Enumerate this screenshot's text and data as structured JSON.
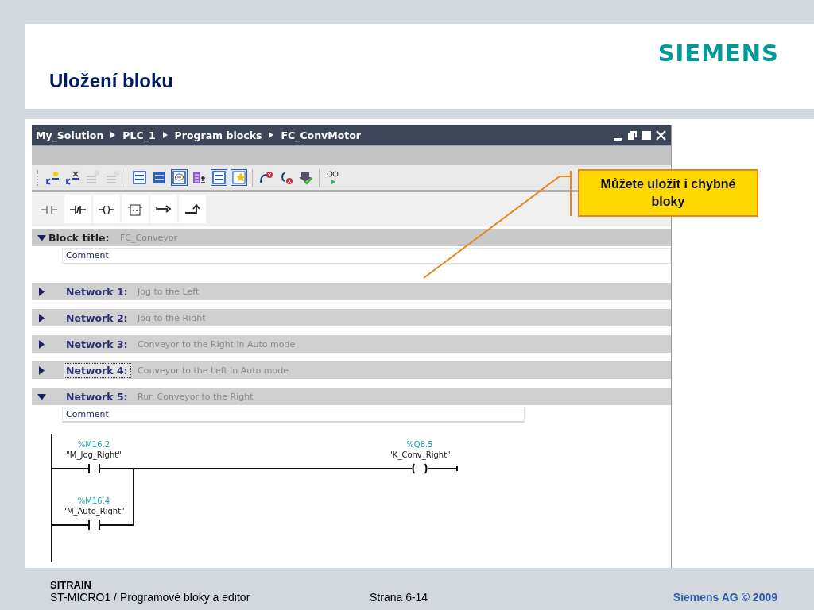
{
  "slide": {
    "title": "Uložení bloku",
    "logo": "SIEMENS"
  },
  "window": {
    "breadcrumb": [
      "My_Solution",
      "PLC_1",
      "Program blocks",
      "FC_ConvMotor"
    ]
  },
  "toolbar": [
    {
      "kind": "insert-network",
      "disabled": false,
      "selected": false
    },
    {
      "kind": "delete-network",
      "disabled": false,
      "selected": false
    },
    {
      "kind": "insert-row",
      "disabled": true,
      "selected": false
    },
    {
      "kind": "insert-row",
      "disabled": true,
      "selected": false
    },
    {
      "kind": "list",
      "disabled": false,
      "selected": false
    },
    {
      "kind": "list-closed",
      "disabled": false,
      "selected": false
    },
    {
      "kind": "comment",
      "disabled": false,
      "selected": true
    },
    {
      "kind": "tag-info",
      "disabled": false,
      "selected": false
    },
    {
      "kind": "list",
      "disabled": false,
      "selected": true
    },
    {
      "kind": "favorites",
      "disabled": false,
      "selected": true
    },
    {
      "kind": "error-prev",
      "disabled": false,
      "selected": false
    },
    {
      "kind": "error-next",
      "disabled": false,
      "selected": false
    },
    {
      "kind": "compile",
      "disabled": false,
      "selected": false
    },
    {
      "kind": "monitor",
      "disabled": false,
      "selected": false
    }
  ],
  "instructions": [
    {
      "kind": "contact-no",
      "disabled": true
    },
    {
      "kind": "contact-nc",
      "disabled": false
    },
    {
      "kind": "coil",
      "disabled": false
    },
    {
      "kind": "empty-box",
      "disabled": false
    },
    {
      "kind": "branch-open",
      "disabled": false
    },
    {
      "kind": "branch-close",
      "disabled": false
    }
  ],
  "block": {
    "label": "Block title:",
    "title": "FC_Conveyor",
    "comment": "Comment",
    "expanded": true
  },
  "networks": [
    {
      "label": "Network 1:",
      "title": "Jog to the Left",
      "expanded": false,
      "focused": false
    },
    {
      "label": "Network 2:",
      "title": "Jog to the Right",
      "expanded": false,
      "focused": false
    },
    {
      "label": "Network 3:",
      "title": "Conveyor to the Right in Auto mode",
      "expanded": false,
      "focused": false
    },
    {
      "label": "Network 4:",
      "title": "Conveyor to the Left in Auto mode",
      "expanded": false,
      "focused": true
    },
    {
      "label": "Network 5:",
      "title": "Run Conveyor to the Right",
      "expanded": true,
      "focused": false,
      "comment": "Comment",
      "ladder": {
        "contacts": [
          {
            "address": "%M16.2",
            "tag": "\"M_Jog_Right\""
          },
          {
            "address": "%M16.4",
            "tag": "\"M_Auto_Right\""
          }
        ],
        "coil": {
          "address": "%Q8.5",
          "tag": "\"K_Conv_Right\""
        }
      }
    }
  ],
  "callout": {
    "text": "Můžete uložit i chybné bloky"
  },
  "footer": {
    "brand": "SITRAIN",
    "course": "ST-MICRO1 / Programové bloky a editor",
    "page": "Strana 6-14",
    "copyright": "Siemens AG © 2009"
  }
}
